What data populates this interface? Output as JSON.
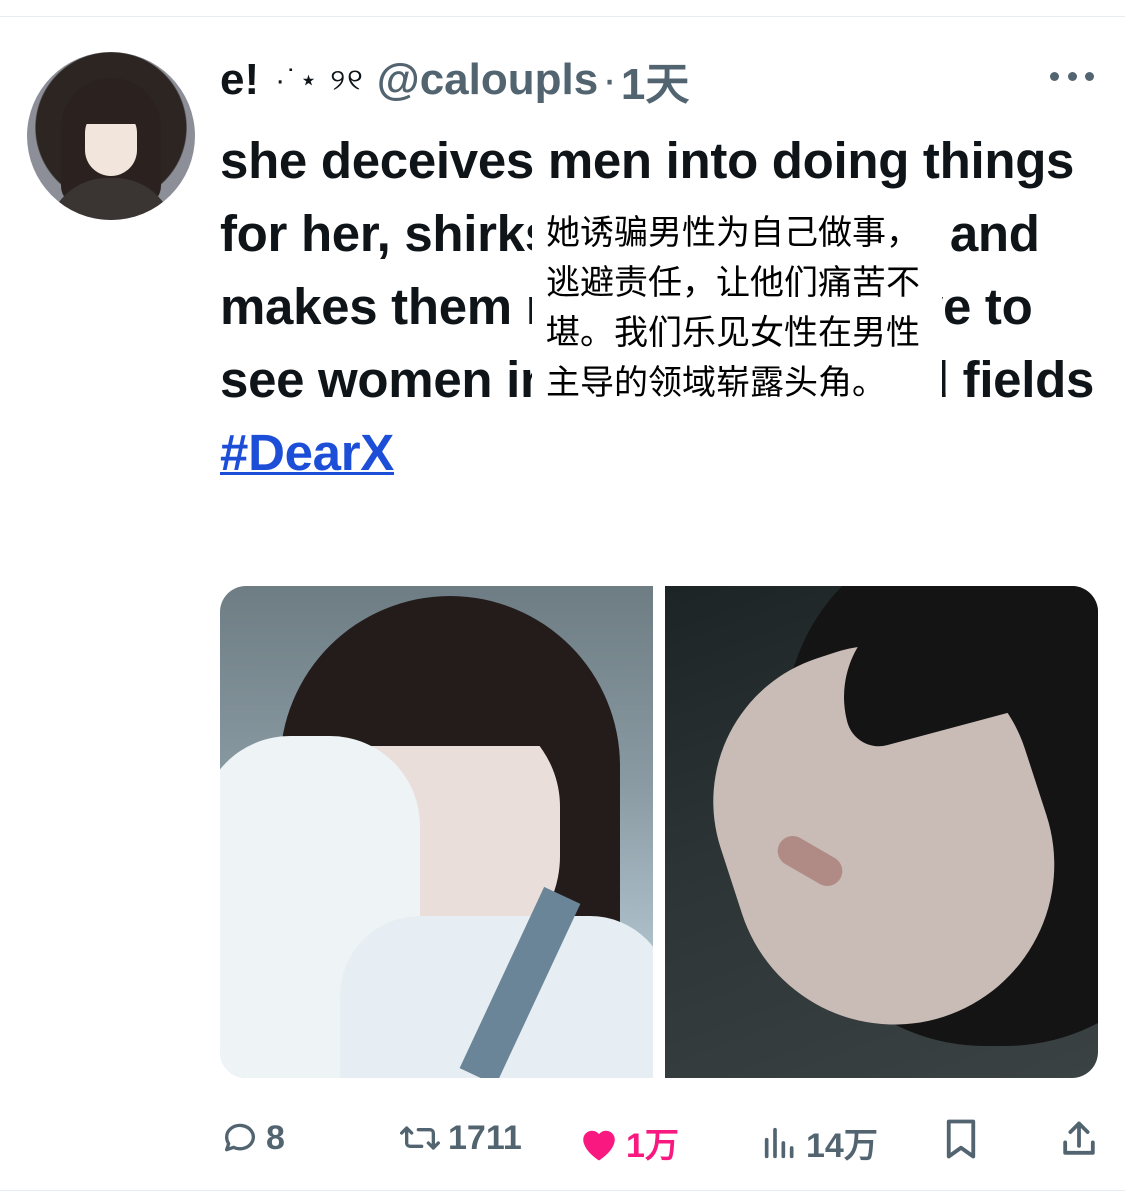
{
  "tweet": {
    "author": {
      "display_name": "e!",
      "display_decoration": "·˙⋆ ୨୧",
      "handle": "@caloupls",
      "separator": "·",
      "time": "1天"
    },
    "text_main": "she deceives men into doing things for her, shirks responsibilities and makes them miserable. we love to see women in male dominated fields",
    "hashtag": "#DearX",
    "translation_overlay": "她诱骗男性为自己做事，逃避责任，让他们痛苦不堪。我们乐见女性在男性主导的领域崭露头角。",
    "media": [
      {
        "alt": "photo-left"
      },
      {
        "alt": "photo-right"
      }
    ],
    "actions": {
      "replies": "8",
      "retweets": "1711",
      "likes": "1万",
      "views": "14万"
    },
    "colors": {
      "like": "#f91880",
      "link": "#1d4ed8",
      "muted": "#536471",
      "text": "#0f1419"
    },
    "icons": {
      "reply": "reply-icon",
      "retweet": "retweet-icon",
      "like": "heart-icon",
      "views": "views-icon",
      "bookmark": "bookmark-icon",
      "share": "share-icon",
      "more": "more-icon"
    }
  }
}
